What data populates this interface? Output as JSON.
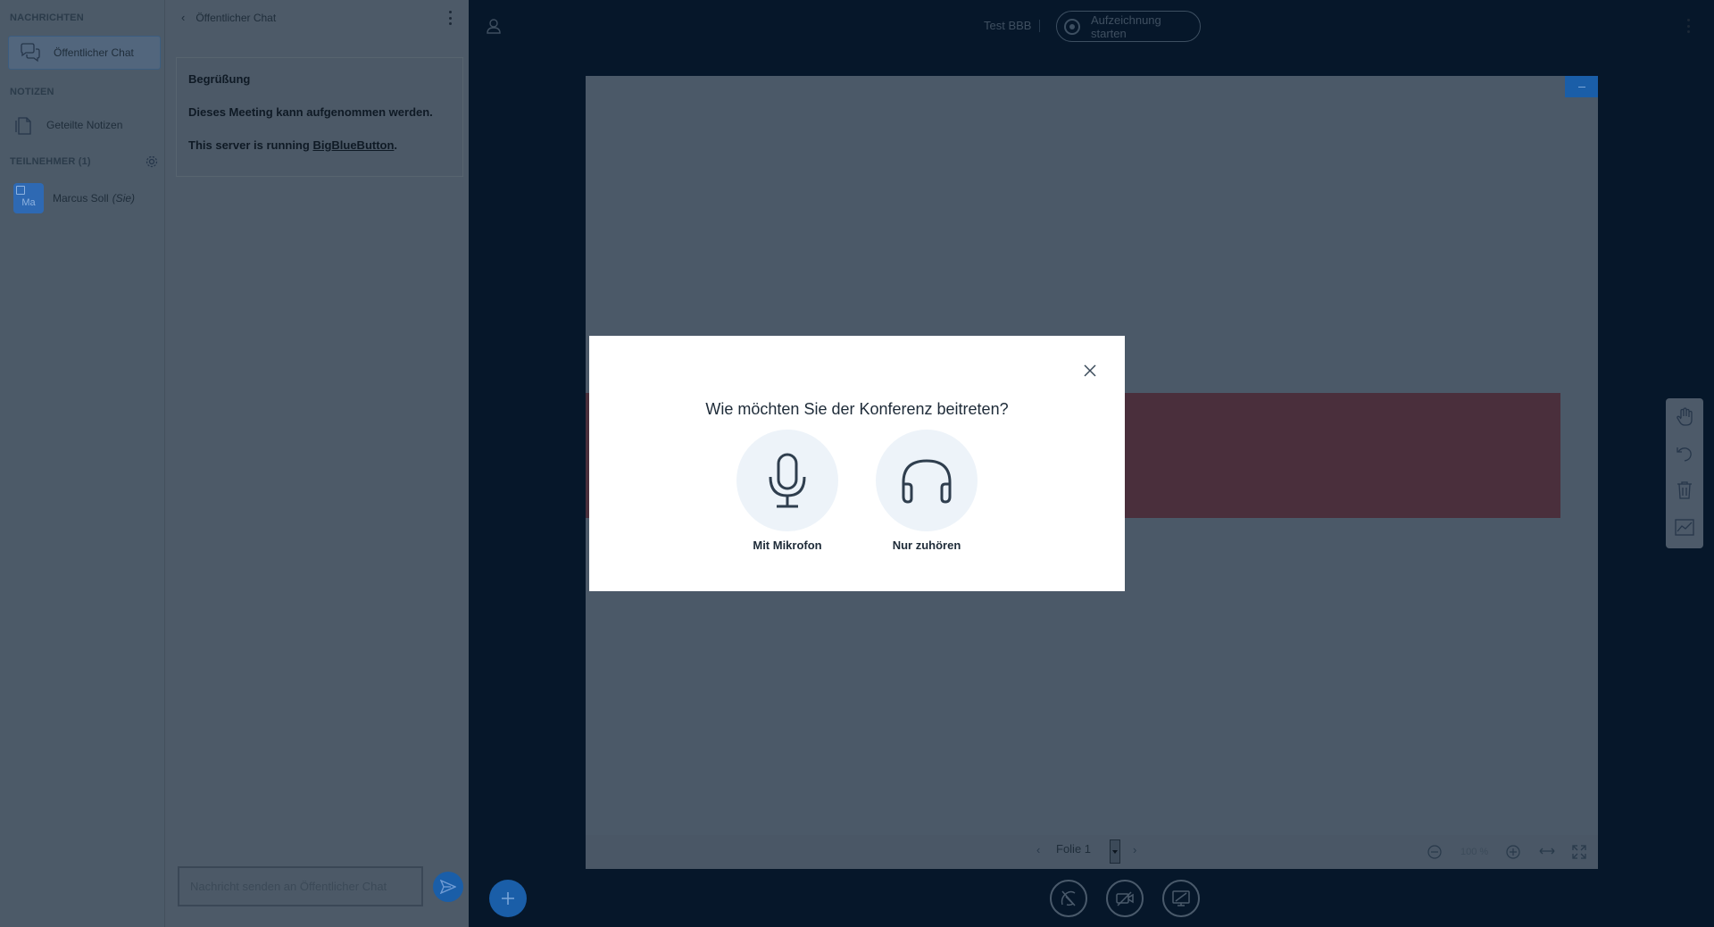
{
  "sidebar": {
    "messages_title": "NACHRICHTEN",
    "public_chat_label": "Öffentlicher Chat",
    "notes_title": "NOTIZEN",
    "shared_notes_label": "Geteilte Notizen",
    "participants_title": "TEILNEHMER (1)",
    "participants": [
      {
        "name": "Marcus Soll",
        "initials": "Ma",
        "you_label": "(Sie)"
      }
    ]
  },
  "chat": {
    "header": "Öffentlicher Chat",
    "welcome_title": "Begrüßung",
    "welcome_line1": "Dieses Meeting kann aufgenommen werden.",
    "welcome_line2_prefix": "This server is running ",
    "welcome_link": "BigBlueButton",
    "welcome_line2_suffix": ".",
    "input_placeholder": "Nachricht senden an Öffentlicher Chat"
  },
  "topbar": {
    "meeting_title": "Test BBB",
    "record_label": "Aufzeichnung starten"
  },
  "presentation": {
    "slide_label": "Folie 1",
    "zoom_label": "100 %"
  },
  "modal": {
    "title": "Wie möchten Sie der Konferenz beitreten?",
    "option_mic": "Mit Mikrofon",
    "option_listen": "Nur zuhören"
  },
  "colors": {
    "accent": "#1a5ea8",
    "background": "#06172a"
  }
}
